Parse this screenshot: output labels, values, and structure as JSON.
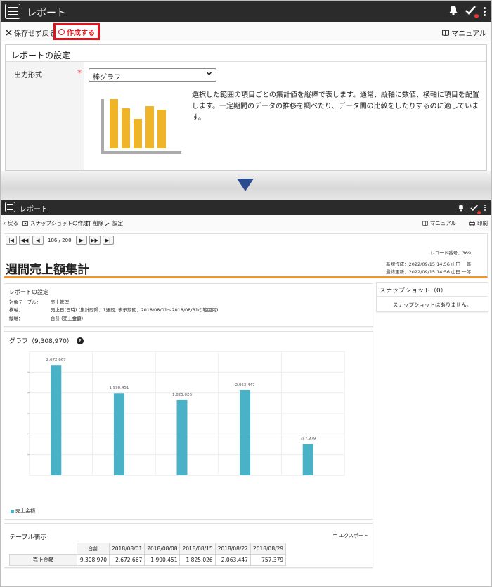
{
  "top_app": {
    "title": "レポート",
    "toolbar": {
      "discard_label": "保存せず戻る",
      "create_label": "作成する",
      "manual_label": "マニュアル"
    },
    "settings_panel": {
      "title": "レポートの設定",
      "output_format_label": "出力形式",
      "required_mark": "*",
      "output_format_value": "棒グラフ",
      "description": "選択した範囲の項目ごとの集計値を縦棒で表します。通常、縦軸に数値、横軸に項目を配置します。一定期間のデータの推移を調べたり、データ間の比較をしたりするのに適しています。"
    }
  },
  "bottom_app": {
    "title": "レポート",
    "toolbar": {
      "back_label": "戻る",
      "snapshot_label": "スナップショットの作成",
      "delete_label": "削除",
      "settings_label": "設定",
      "manual_label": "マニュアル",
      "print_label": "印刷"
    },
    "pager": {
      "text": "186 / 200"
    },
    "report": {
      "title": "週間売上額集計",
      "record_no": "レコード番号：369",
      "created": "新規作成：2022/09/15 14:56 山田 一郎",
      "updated": "最終更新：2022/09/15 14:56 山田 一郎"
    },
    "report_settings": {
      "title": "レポートの設定",
      "rows": [
        {
          "key": "対象テーブル：",
          "value": "売上管理"
        },
        {
          "key": "横軸：",
          "value": "売上日(日時) (集計間隔：1週間, 表示期間：2018/08/01〜2018/08/31の範囲内)"
        },
        {
          "key": "縦軸：",
          "value": "合計 (売上金額)"
        }
      ]
    },
    "snapshot": {
      "title": "スナップショット（0）",
      "empty": "スナップショットはありません。"
    },
    "graph": {
      "title": "グラフ（9,308,970）",
      "legend": "売上金額"
    },
    "table": {
      "title": "テーブル表示",
      "export_label": "エクスポート",
      "headers": [
        "合計",
        "2018/08/01",
        "2018/08/08",
        "2018/08/15",
        "2018/08/22",
        "2018/08/29"
      ],
      "row_label": "売上金額",
      "row_values": [
        "9,308,970",
        "2,672,667",
        "1,990,451",
        "1,825,026",
        "2,063,447",
        "757,379"
      ]
    }
  },
  "colors": {
    "accent_red": "#e0141d",
    "bar": "#4ab2c6",
    "orange_rule": "#f0942b",
    "mini_bar": "#f0b429",
    "arrow": "#2a4c8f"
  },
  "mini_chart": {
    "values": [
      70,
      57,
      42,
      60,
      55
    ]
  },
  "chart_data": {
    "type": "bar",
    "categories": [
      "2018/08/01",
      "2018/08/08",
      "2018/08/15",
      "2018/08/22",
      "2018/08/29"
    ],
    "series": [
      {
        "name": "売上金額",
        "values": [
          2672667,
          1990451,
          1825026,
          2063447,
          757379
        ]
      }
    ],
    "data_labels": [
      "2,672,667",
      "1,990,451",
      "1,825,026",
      "2,063,447",
      "757,379"
    ],
    "title": "グラフ（9,308,970）",
    "xlabel": "",
    "ylabel": "",
    "ylim": [
      0,
      3000000
    ],
    "grid": true,
    "legend": "bottom-left"
  }
}
